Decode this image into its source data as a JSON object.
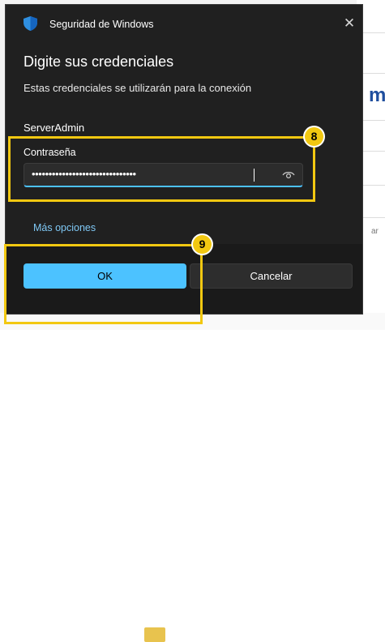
{
  "dialog": {
    "title": "Seguridad de Windows",
    "heading": "Digite sus credenciales",
    "subtext": "Estas credenciales se utilizarán para la conexión",
    "username": "ServerAdmin",
    "password_label": "Contraseña",
    "password_value": "•••••••••••••••••••••••••••••••",
    "more_options": "Más opciones",
    "ok_label": "OK",
    "cancel_label": "Cancelar",
    "close_glyph": "✕"
  },
  "annotations": [
    {
      "label": "8"
    },
    {
      "label": "9"
    }
  ],
  "background_app": {
    "glyph": "m",
    "small_text": "ar"
  },
  "colors": {
    "accent": "#4cc2ff",
    "highlight": "#f2c811",
    "dialog_bg": "#202020"
  },
  "icons": {
    "shield": "shield-icon",
    "close": "close-icon",
    "reveal_password": "eye-icon"
  }
}
